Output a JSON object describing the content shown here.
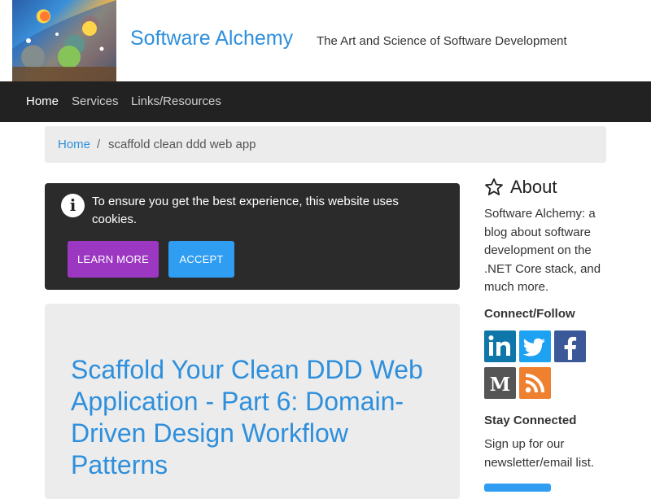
{
  "site": {
    "title": "Software Alchemy",
    "tagline": "The Art and Science of Software Development"
  },
  "nav": {
    "items": [
      {
        "label": "Home",
        "active": true
      },
      {
        "label": "Services",
        "active": false
      },
      {
        "label": "Links/Resources",
        "active": false
      }
    ]
  },
  "breadcrumb": {
    "home": "Home",
    "separator": "/",
    "current": "scaffold clean ddd web app"
  },
  "cookie_banner": {
    "message": "To ensure you get the best experience, this website uses cookies.",
    "learn_more_label": "LEARN MORE",
    "accept_label": "ACCEPT",
    "learn_more_color": "#9c37c2",
    "accept_color": "#2f9df2"
  },
  "article": {
    "title": "Scaffold Your Clean DDD Web Application - Part 6: Domain-Driven Design Workflow Patterns"
  },
  "sidebar": {
    "about_heading": "About",
    "about_text": "Software Alchemy: a blog about software development on the .NET Core stack, and much more.",
    "connect_heading": "Connect/Follow",
    "social": [
      {
        "icon": "linkedin-icon",
        "glyph": "in",
        "color": "#0e76a8"
      },
      {
        "icon": "twitter-icon",
        "glyph": "🐦",
        "color": "#1da1f2"
      },
      {
        "icon": "facebook-icon",
        "glyph": "f",
        "color": "#3b5998"
      },
      {
        "icon": "medium-icon",
        "glyph": "M",
        "color": "#555555"
      },
      {
        "icon": "rss-icon",
        "glyph": "rss",
        "color": "#ee802f"
      }
    ],
    "stay_connected_heading": "Stay Connected",
    "newsletter_text": "Sign up for our newsletter/email list."
  },
  "colors": {
    "accent": "#2e8fdc",
    "navbar": "#222222"
  }
}
